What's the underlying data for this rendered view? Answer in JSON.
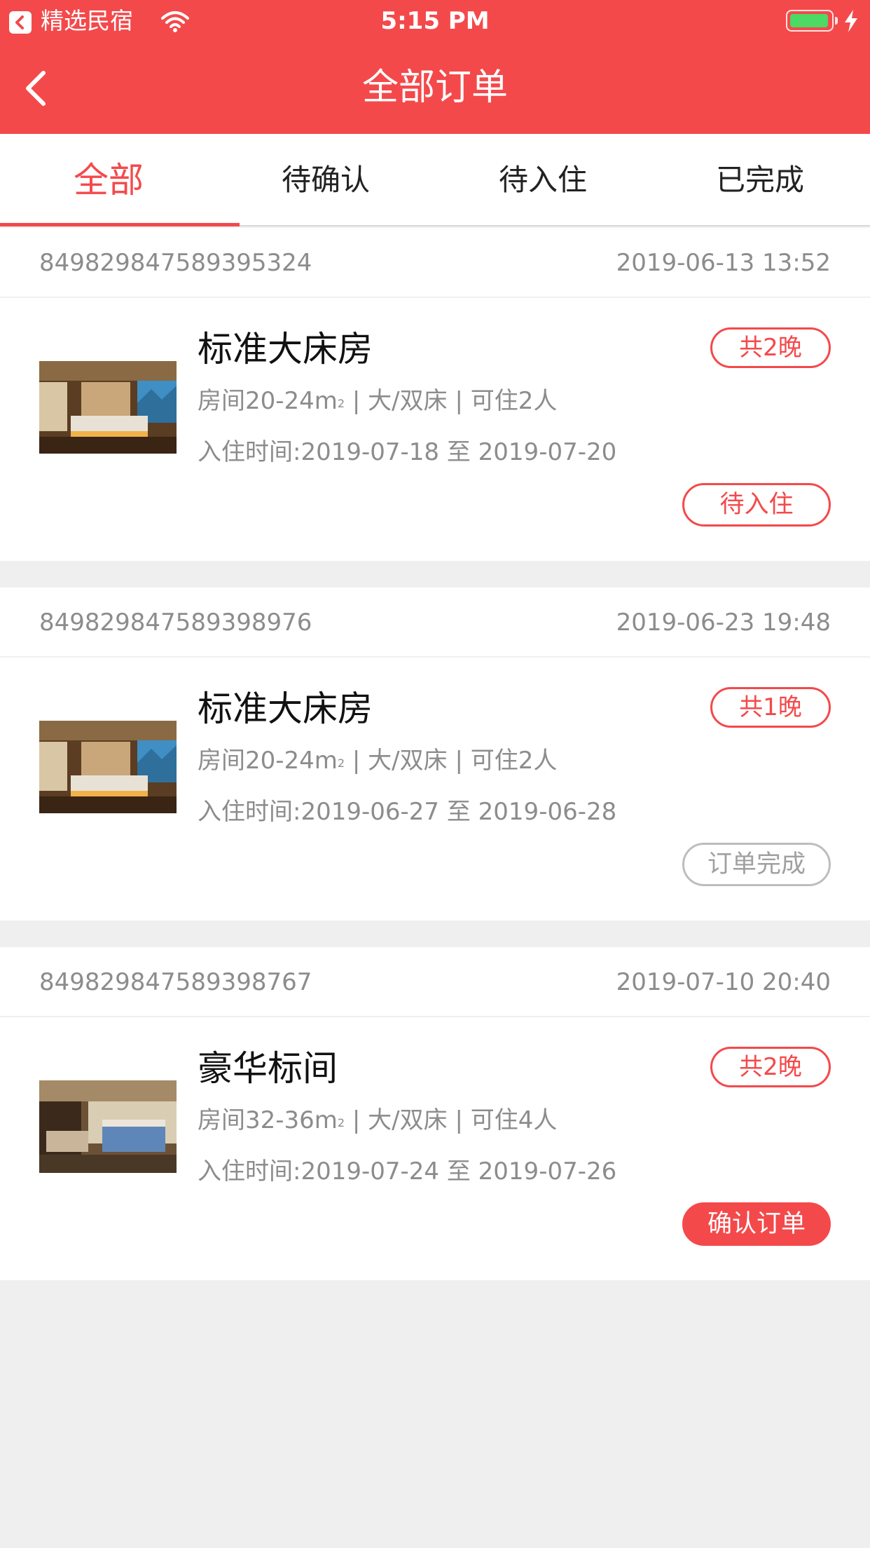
{
  "status_bar": {
    "app_name": "精选民宿",
    "time": "5:15 PM"
  },
  "nav": {
    "title": "全部订单"
  },
  "tabs": [
    {
      "label": "全部",
      "active": true
    },
    {
      "label": "待确认",
      "active": false
    },
    {
      "label": "待入住",
      "active": false
    },
    {
      "label": "已完成",
      "active": false
    }
  ],
  "orders": [
    {
      "order_no": "849829847589395324",
      "created": "2019-06-13 13:52",
      "room_name": "标准大床房",
      "nights": "共2晚",
      "size": "房间20-24m",
      "sup": "2",
      "spec_rest": " | 大/双床 | 可住2人",
      "checkin": "入住时间:2019-07-18 至 2019-07-20",
      "action": "待入住",
      "action_style": "outline"
    },
    {
      "order_no": "849829847589398976",
      "created": "2019-06-23 19:48",
      "room_name": "标准大床房",
      "nights": "共1晚",
      "size": "房间20-24m",
      "sup": "2",
      "spec_rest": " | 大/双床 | 可住2人",
      "checkin": "入住时间:2019-06-27 至 2019-06-28",
      "action": "订单完成",
      "action_style": "done"
    },
    {
      "order_no": "849829847589398767",
      "created": "2019-07-10 20:40",
      "room_name": "豪华标间",
      "nights": "共2晚",
      "size": "房间32-36m",
      "sup": "2",
      "spec_rest": " | 大/双床 | 可住4人",
      "checkin": "入住时间:2019-07-24 至 2019-07-26",
      "action": "确认订单",
      "action_style": "primary"
    }
  ],
  "colors": {
    "brand": "#f4494b",
    "muted_text": "#8c8c8c",
    "background": "#efefef"
  }
}
